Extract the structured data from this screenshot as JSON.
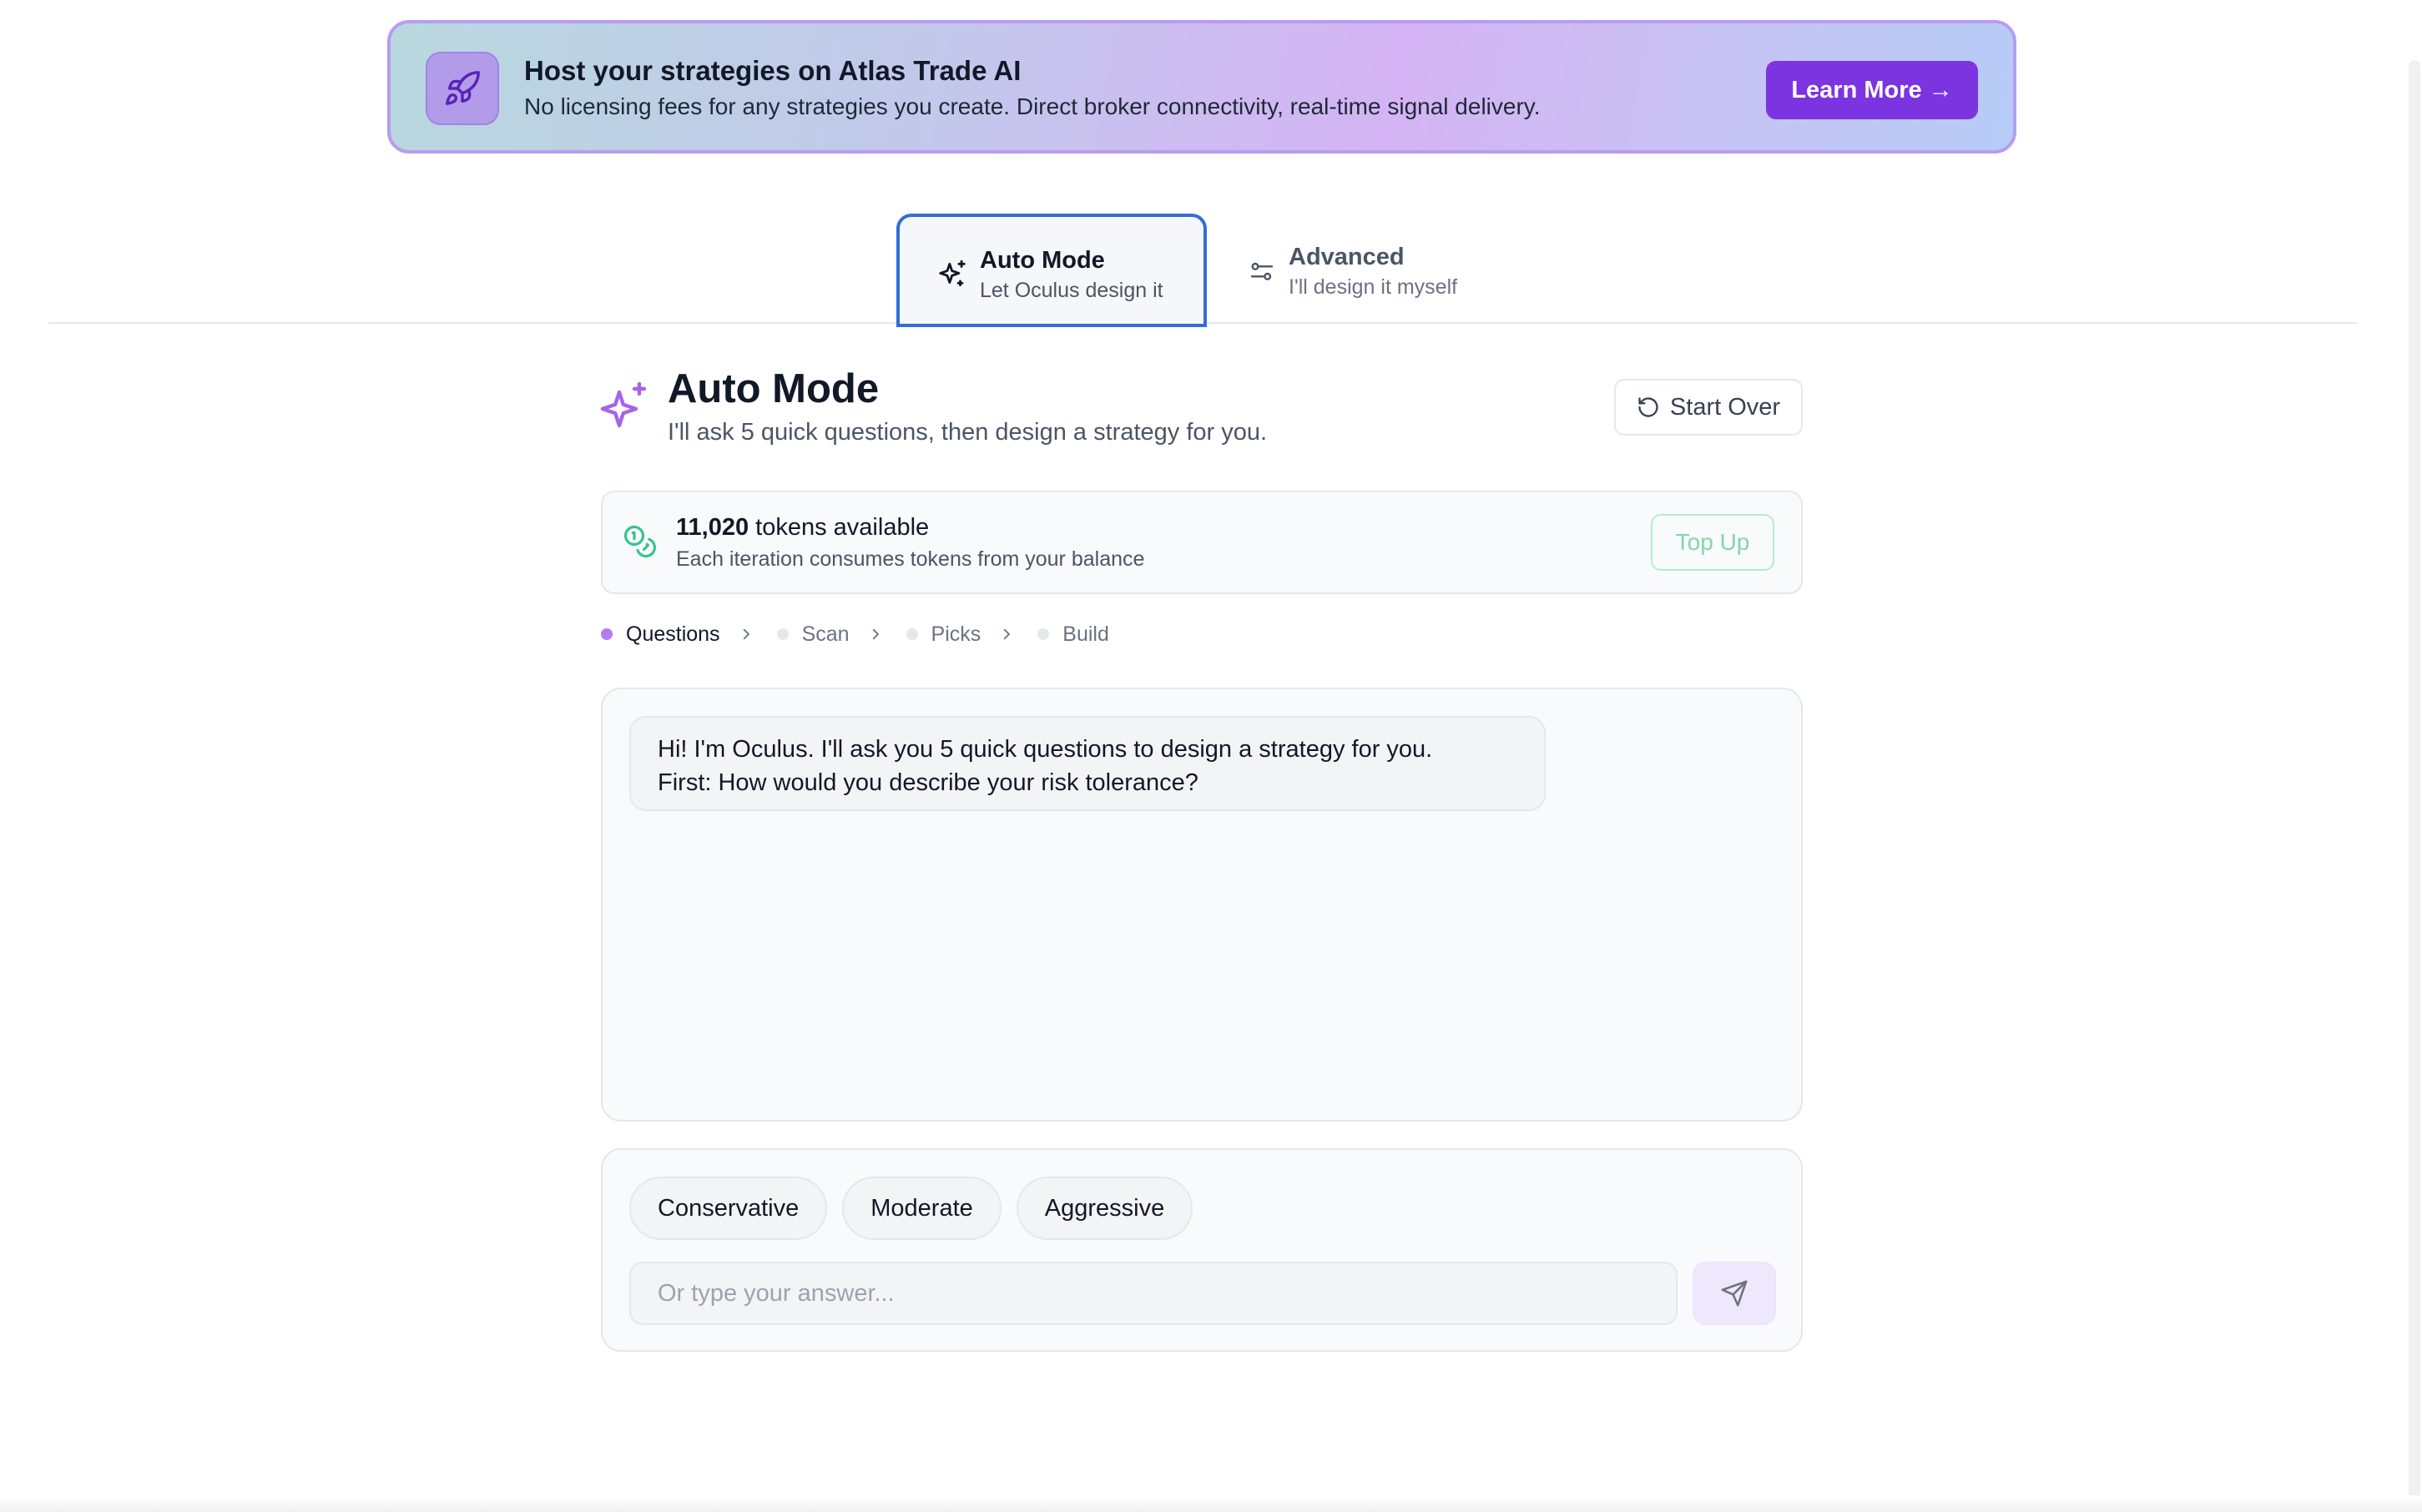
{
  "banner": {
    "title": "Host your strategies on Atlas Trade AI",
    "description": "No licensing fees for any strategies you create. Direct broker connectivity, real-time signal delivery.",
    "cta_label": "Learn More →",
    "icon": "rocket-icon"
  },
  "mode_tabs": [
    {
      "title": "Auto Mode",
      "subtitle": "Let Oculus design it",
      "icon": "sparkle-icon",
      "active": true
    },
    {
      "title": "Advanced",
      "subtitle": "I'll design it myself",
      "icon": "sliders-icon",
      "active": false
    }
  ],
  "header": {
    "title": "Auto Mode",
    "subtitle": "I'll ask 5 quick questions, then design a strategy for you.",
    "start_over_label": "Start Over"
  },
  "tokens": {
    "count": "11,020",
    "label": "tokens available",
    "subtext": "Each iteration consumes tokens from your balance",
    "top_up_label": "Top Up"
  },
  "steps": [
    {
      "label": "Questions",
      "active": true
    },
    {
      "label": "Scan",
      "active": false
    },
    {
      "label": "Picks",
      "active": false
    },
    {
      "label": "Build",
      "active": false
    }
  ],
  "chat": {
    "messages": [
      {
        "line1": "Hi! I'm Oculus. I'll ask you 5 quick questions to design a strategy for you.",
        "line2": "First: How would you describe your risk tolerance?"
      }
    ]
  },
  "answer": {
    "options": [
      "Conservative",
      "Moderate",
      "Aggressive"
    ],
    "placeholder": "Or type your answer..."
  },
  "colors": {
    "accent": "#7c33e0",
    "active_tab_border": "#2f6fd8",
    "step_active": "#b17cf0",
    "tokens_green": "#34c48a"
  }
}
